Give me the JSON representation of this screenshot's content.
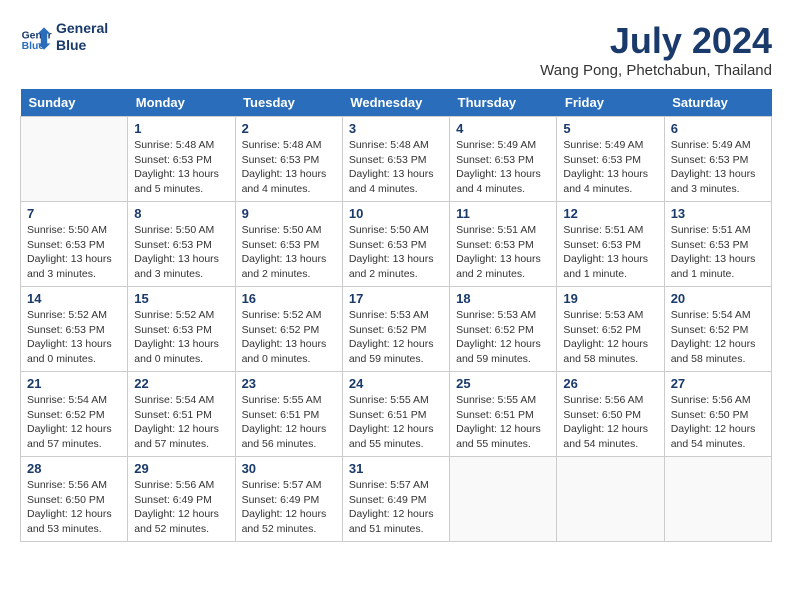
{
  "header": {
    "logo_line1": "General",
    "logo_line2": "Blue",
    "month_title": "July 2024",
    "location": "Wang Pong, Phetchabun, Thailand"
  },
  "days": [
    "Sunday",
    "Monday",
    "Tuesday",
    "Wednesday",
    "Thursday",
    "Friday",
    "Saturday"
  ],
  "weeks": [
    [
      {
        "date": "",
        "info": ""
      },
      {
        "date": "1",
        "info": "Sunrise: 5:48 AM\nSunset: 6:53 PM\nDaylight: 13 hours\nand 5 minutes."
      },
      {
        "date": "2",
        "info": "Sunrise: 5:48 AM\nSunset: 6:53 PM\nDaylight: 13 hours\nand 4 minutes."
      },
      {
        "date": "3",
        "info": "Sunrise: 5:48 AM\nSunset: 6:53 PM\nDaylight: 13 hours\nand 4 minutes."
      },
      {
        "date": "4",
        "info": "Sunrise: 5:49 AM\nSunset: 6:53 PM\nDaylight: 13 hours\nand 4 minutes."
      },
      {
        "date": "5",
        "info": "Sunrise: 5:49 AM\nSunset: 6:53 PM\nDaylight: 13 hours\nand 4 minutes."
      },
      {
        "date": "6",
        "info": "Sunrise: 5:49 AM\nSunset: 6:53 PM\nDaylight: 13 hours\nand 3 minutes."
      }
    ],
    [
      {
        "date": "7",
        "info": "Sunrise: 5:50 AM\nSunset: 6:53 PM\nDaylight: 13 hours\nand 3 minutes."
      },
      {
        "date": "8",
        "info": "Sunrise: 5:50 AM\nSunset: 6:53 PM\nDaylight: 13 hours\nand 3 minutes."
      },
      {
        "date": "9",
        "info": "Sunrise: 5:50 AM\nSunset: 6:53 PM\nDaylight: 13 hours\nand 2 minutes."
      },
      {
        "date": "10",
        "info": "Sunrise: 5:50 AM\nSunset: 6:53 PM\nDaylight: 13 hours\nand 2 minutes."
      },
      {
        "date": "11",
        "info": "Sunrise: 5:51 AM\nSunset: 6:53 PM\nDaylight: 13 hours\nand 2 minutes."
      },
      {
        "date": "12",
        "info": "Sunrise: 5:51 AM\nSunset: 6:53 PM\nDaylight: 13 hours\nand 1 minute."
      },
      {
        "date": "13",
        "info": "Sunrise: 5:51 AM\nSunset: 6:53 PM\nDaylight: 13 hours\nand 1 minute."
      }
    ],
    [
      {
        "date": "14",
        "info": "Sunrise: 5:52 AM\nSunset: 6:53 PM\nDaylight: 13 hours\nand 0 minutes."
      },
      {
        "date": "15",
        "info": "Sunrise: 5:52 AM\nSunset: 6:53 PM\nDaylight: 13 hours\nand 0 minutes."
      },
      {
        "date": "16",
        "info": "Sunrise: 5:52 AM\nSunset: 6:52 PM\nDaylight: 13 hours\nand 0 minutes."
      },
      {
        "date": "17",
        "info": "Sunrise: 5:53 AM\nSunset: 6:52 PM\nDaylight: 12 hours\nand 59 minutes."
      },
      {
        "date": "18",
        "info": "Sunrise: 5:53 AM\nSunset: 6:52 PM\nDaylight: 12 hours\nand 59 minutes."
      },
      {
        "date": "19",
        "info": "Sunrise: 5:53 AM\nSunset: 6:52 PM\nDaylight: 12 hours\nand 58 minutes."
      },
      {
        "date": "20",
        "info": "Sunrise: 5:54 AM\nSunset: 6:52 PM\nDaylight: 12 hours\nand 58 minutes."
      }
    ],
    [
      {
        "date": "21",
        "info": "Sunrise: 5:54 AM\nSunset: 6:52 PM\nDaylight: 12 hours\nand 57 minutes."
      },
      {
        "date": "22",
        "info": "Sunrise: 5:54 AM\nSunset: 6:51 PM\nDaylight: 12 hours\nand 57 minutes."
      },
      {
        "date": "23",
        "info": "Sunrise: 5:55 AM\nSunset: 6:51 PM\nDaylight: 12 hours\nand 56 minutes."
      },
      {
        "date": "24",
        "info": "Sunrise: 5:55 AM\nSunset: 6:51 PM\nDaylight: 12 hours\nand 55 minutes."
      },
      {
        "date": "25",
        "info": "Sunrise: 5:55 AM\nSunset: 6:51 PM\nDaylight: 12 hours\nand 55 minutes."
      },
      {
        "date": "26",
        "info": "Sunrise: 5:56 AM\nSunset: 6:50 PM\nDaylight: 12 hours\nand 54 minutes."
      },
      {
        "date": "27",
        "info": "Sunrise: 5:56 AM\nSunset: 6:50 PM\nDaylight: 12 hours\nand 54 minutes."
      }
    ],
    [
      {
        "date": "28",
        "info": "Sunrise: 5:56 AM\nSunset: 6:50 PM\nDaylight: 12 hours\nand 53 minutes."
      },
      {
        "date": "29",
        "info": "Sunrise: 5:56 AM\nSunset: 6:49 PM\nDaylight: 12 hours\nand 52 minutes."
      },
      {
        "date": "30",
        "info": "Sunrise: 5:57 AM\nSunset: 6:49 PM\nDaylight: 12 hours\nand 52 minutes."
      },
      {
        "date": "31",
        "info": "Sunrise: 5:57 AM\nSunset: 6:49 PM\nDaylight: 12 hours\nand 51 minutes."
      },
      {
        "date": "",
        "info": ""
      },
      {
        "date": "",
        "info": ""
      },
      {
        "date": "",
        "info": ""
      }
    ]
  ]
}
